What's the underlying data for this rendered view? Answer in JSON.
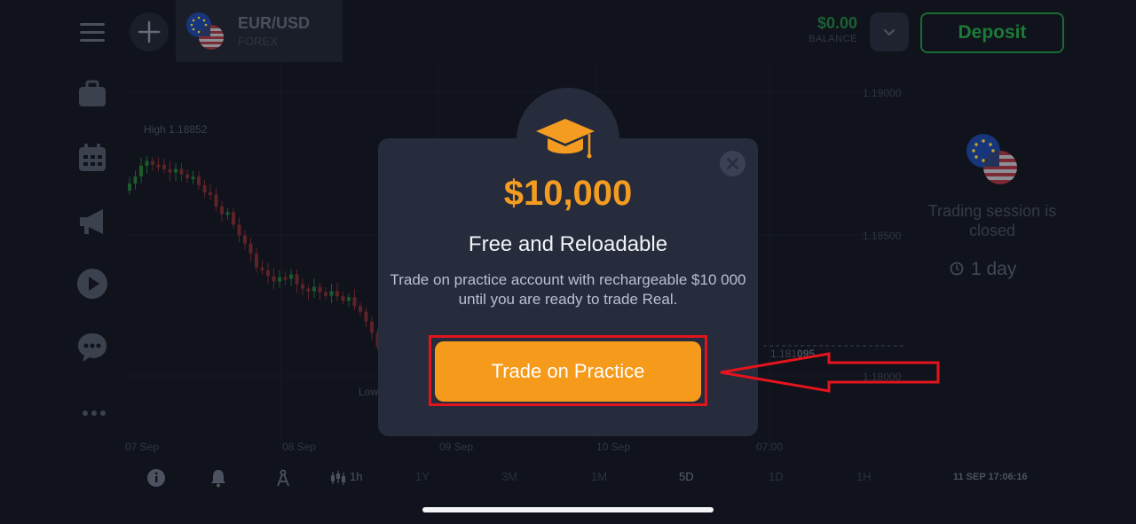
{
  "app": {
    "asset": {
      "pair": "EUR/USD",
      "type": "FOREX"
    },
    "balance": {
      "value": "$0.00",
      "label": "BALANCE"
    },
    "deposit_label": "Deposit"
  },
  "chart": {
    "price_labels": [
      "1.19000",
      "1.18500",
      "1.18000"
    ],
    "current_price": "1.181",
    "current_price_suffix": "095",
    "high_label": "High 1.18852",
    "low_label": "Low",
    "date_labels": [
      "07 Sep",
      "08 Sep",
      "09 Sep",
      "10 Sep",
      "07:00"
    ]
  },
  "session": {
    "status": "Trading session is closed",
    "time_left": "1 day"
  },
  "toolbar": {
    "candle_interval": "1h",
    "periods": [
      "1Y",
      "3M",
      "1M",
      "5D",
      "1D",
      "1H"
    ],
    "active_period": "5D",
    "datetime": "11 SEP 17:06:16"
  },
  "modal": {
    "amount": "$10,000",
    "subtitle": "Free and Reloadable",
    "description": "Trade on practice account with rechargeable $10 000 until you are ready to trade Real.",
    "cta_label": "Trade on Practice"
  },
  "colors": {
    "accent_orange": "#f59a1b",
    "deposit_green": "#1c7a37",
    "highlight_red": "#e3141c",
    "background": "#10131c",
    "modal_bg": "#262c3c"
  }
}
